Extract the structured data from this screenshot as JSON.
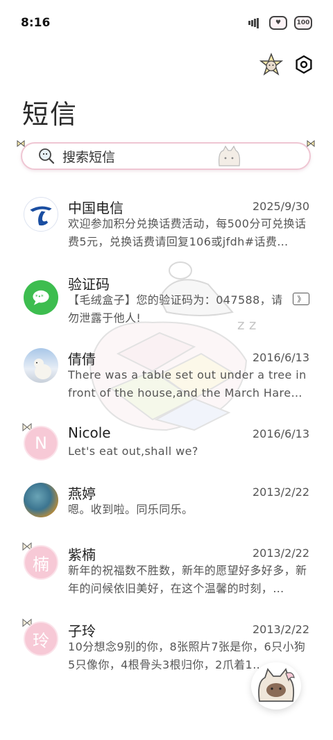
{
  "status_bar": {
    "time": "8:16",
    "icons": [
      "signal-icon",
      "heart-icon",
      "battery-icon"
    ],
    "battery_text": "100"
  },
  "header": {
    "title": "短信",
    "actions": [
      "sticker-icon",
      "settings-icon"
    ]
  },
  "search": {
    "placeholder": "搜索短信",
    "border_color": "#efc6d3"
  },
  "conversations": [
    {
      "name": "中国电信",
      "date": "2025/9/30",
      "preview": "欢迎参加积分兑换话费活动，每500分可兑换话费5元，兑换话费请回复106或jfdh#话费…",
      "avatar": "china-telecom-logo-icon"
    },
    {
      "name": "验证码",
      "date": "",
      "preview": "【毛绒盒子】您的验证码为：047588，请勿泄露于他人!",
      "avatar": "message-bubble-icon",
      "badge": "》"
    },
    {
      "name": "倩倩",
      "date": "2016/6/13",
      "preview": "There was a table set out under a tree in front of the house,and the March Hare an…",
      "avatar": "polar-bear-photo"
    },
    {
      "name": "Nicole",
      "date": "2016/6/13",
      "preview": "Let's eat out,shall we?",
      "avatar_letter": "N"
    },
    {
      "name": "燕婷",
      "date": "2013/2/22",
      "preview": "嗯。收到啦。同乐同乐。",
      "avatar": "landscape-photo"
    },
    {
      "name": "紫楠",
      "date": "2013/2/22",
      "preview": "新年的祝福数不胜数，新年的愿望好多好多，新年的问候依旧美好，在这个温馨的时刻，…",
      "avatar_letter": "楠"
    },
    {
      "name": "子玲",
      "date": "2013/2/22",
      "preview": "10分想念9别的你，8张照片7张是你，6只小狗5只像你，4根骨头3根归你，2爪着1…",
      "avatar_letter": "玲"
    }
  ],
  "fab": {
    "icon": "compose-cat-icon"
  },
  "colors": {
    "accent_pink": "#f7c9d6",
    "green": "#3dbd4f",
    "telecom_blue": "#1a4ea1"
  }
}
